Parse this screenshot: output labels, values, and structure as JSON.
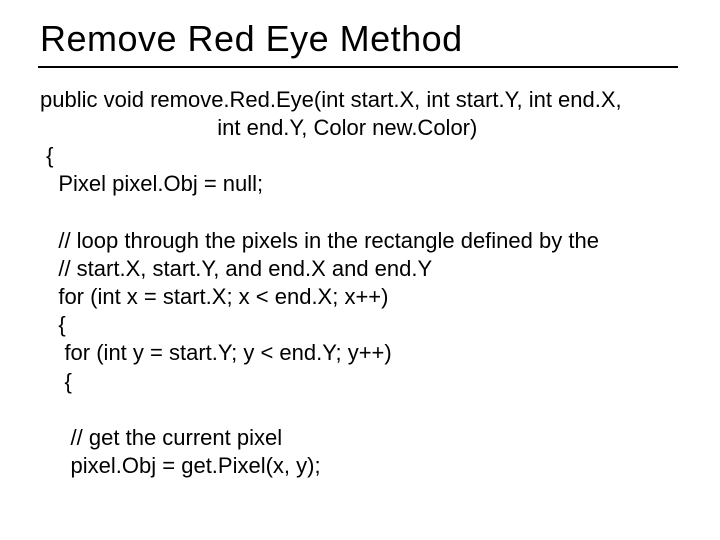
{
  "title": "Remove Red Eye Method",
  "code_lines": [
    "public void remove.Red.Eye(int start.X, int start.Y, int end.X,",
    "                             int end.Y, Color new.Color)",
    " {",
    "   Pixel pixel.Obj = null;",
    "",
    "   // loop through the pixels in the rectangle defined by the",
    "   // start.X, start.Y, and end.X and end.Y",
    "   for (int x = start.X; x < end.X; x++)",
    "   {",
    "    for (int y = start.Y; y < end.Y; y++)",
    "    {",
    "",
    "     // get the current pixel",
    "     pixel.Obj = get.Pixel(x, y);"
  ]
}
